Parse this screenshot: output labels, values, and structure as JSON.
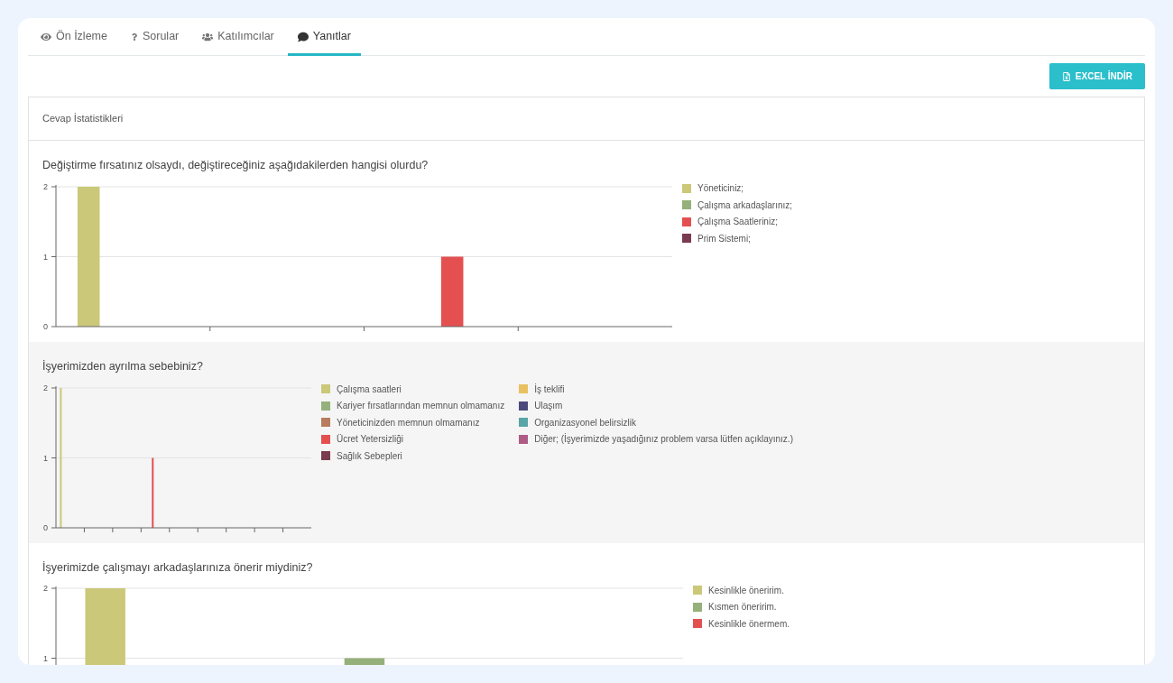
{
  "tabs": [
    {
      "kind": "preview",
      "label": "Ön İzleme",
      "selected": false
    },
    {
      "kind": "questions",
      "label": "Sorular",
      "selected": false
    },
    {
      "kind": "participants",
      "label": "Katılımcılar",
      "selected": false
    },
    {
      "kind": "answers",
      "label": "Yanıtlar",
      "selected": true
    }
  ],
  "export_button": "EXCEL İNDİR",
  "panel_title": "Cevap İstatistikleri",
  "questions": [
    {
      "title": "Değiştirme fırsatınız olsaydı, değiştireceğiniz aşağıdakilerden hangisi olurdu?",
      "chart_data": {
        "type": "bar",
        "ylim": [
          0,
          2
        ],
        "yticks": [
          0,
          1,
          2
        ],
        "series": [
          {
            "name": "Yöneticiniz;",
            "color": "#cbc87a",
            "values": [
              2,
              0,
              0,
              0
            ]
          },
          {
            "name": "Çalışma arkadaşlarınız;",
            "color": "#95b07a",
            "values": [
              0,
              0,
              0,
              0
            ]
          },
          {
            "name": "Çalışma Saatleriniz;",
            "color": "#e45050",
            "values": [
              0,
              0,
              1,
              0
            ]
          },
          {
            "name": "Prim Sistemi;",
            "color": "#7a3b4f",
            "values": [
              0,
              0,
              0,
              0
            ]
          }
        ]
      }
    },
    {
      "title": "İşyerimizden ayrılma sebebiniz?",
      "chart_data": {
        "type": "bar",
        "ylim": [
          0,
          2
        ],
        "yticks": [
          0,
          1,
          2
        ],
        "series": [
          {
            "name": "Çalışma saatleri",
            "color": "#cbc87a",
            "values": [
              2,
              0,
              0,
              0,
              0,
              0,
              0,
              0,
              0
            ]
          },
          {
            "name": "Kariyer fırsatlarından memnun olmamanız",
            "color": "#95b07a",
            "values": [
              0,
              0,
              0,
              0,
              0,
              0,
              0,
              0,
              0
            ]
          },
          {
            "name": "Yöneticinizden memnun olmamanız",
            "color": "#b87d5f",
            "values": [
              0,
              0,
              0,
              0,
              0,
              0,
              0,
              0,
              0
            ]
          },
          {
            "name": "Ücret Yetersizliği",
            "color": "#e45050",
            "values": [
              0,
              0,
              0,
              1,
              0,
              0,
              0,
              0,
              0
            ]
          },
          {
            "name": "Sağlık Sebepleri",
            "color": "#7a3b4f",
            "values": [
              0,
              0,
              0,
              0,
              0,
              0,
              0,
              0,
              0
            ]
          },
          {
            "name": "İş teklifi",
            "color": "#e8c060",
            "values": [
              0,
              0,
              0,
              0,
              0,
              0,
              0,
              0,
              0
            ]
          },
          {
            "name": "Ulaşım",
            "color": "#4b4a7a",
            "values": [
              0,
              0,
              0,
              0,
              0,
              0,
              0,
              0,
              0
            ]
          },
          {
            "name": "Organizasyonel belirsizlik",
            "color": "#5aa5a6",
            "values": [
              0,
              0,
              0,
              0,
              0,
              0,
              0,
              0,
              0
            ]
          },
          {
            "name": "Diğer; (İşyerimizde yaşadığınız problem varsa lütfen açıklayınız.)",
            "color": "#ad5c85",
            "values": [
              0,
              0,
              0,
              0,
              0,
              0,
              0,
              0,
              0
            ]
          }
        ]
      }
    },
    {
      "title": "İşyerimizde çalışmayı arkadaşlarınıza önerir miydiniz?",
      "chart_data": {
        "type": "bar",
        "ylim": [
          0,
          2
        ],
        "yticks": [
          1,
          2
        ],
        "series": [
          {
            "name": "Kesinlikle öneririm.",
            "color": "#cbc87a",
            "values": [
              2,
              0,
              0
            ]
          },
          {
            "name": "Kısmen öneririm.",
            "color": "#95b07a",
            "values": [
              0,
              1,
              0
            ]
          },
          {
            "name": "Kesinlikle önermem.",
            "color": "#e45050",
            "values": [
              0,
              0,
              0
            ]
          }
        ]
      }
    }
  ]
}
